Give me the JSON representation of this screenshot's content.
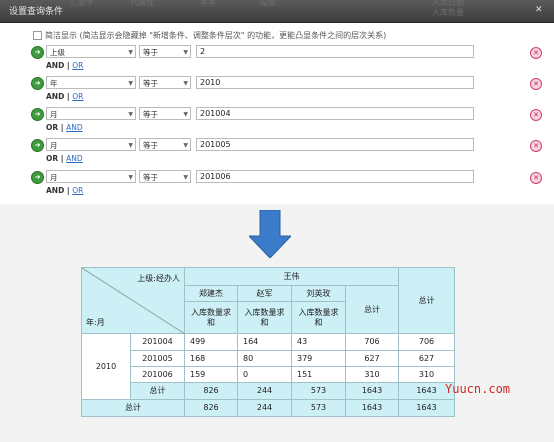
{
  "dialog": {
    "title": "设置查询条件",
    "bg_tabs": [
      "汇总字",
      "列属性",
      "等等",
      "设置",
      "入库日期",
      "入库数量"
    ],
    "simple_label": "简洁显示 (简洁显示会隐藏掉 \"新增条件、调整条件层次\" 的功能，更能凸显条件之间的层次关系)",
    "close_glyph": "✕",
    "conditions": [
      {
        "field": "上级",
        "op": "等于",
        "value": "2",
        "logic": "AND",
        "logic_alt": "OR"
      },
      {
        "field": "年",
        "op": "等于",
        "value": "2010",
        "logic": "AND",
        "logic_alt": "OR"
      },
      {
        "field": "月",
        "op": "等于",
        "value": "201004",
        "logic": "OR",
        "logic_alt": "AND"
      },
      {
        "field": "月",
        "op": "等于",
        "value": "201005",
        "logic": "OR",
        "logic_alt": "AND"
      },
      {
        "field": "月",
        "op": "等于",
        "value": "201006",
        "logic": "AND",
        "logic_alt": "OR"
      }
    ]
  },
  "colors": {
    "accent": "#3a7cc9",
    "header_bg": "#cdeff6",
    "watermark": "#d02a2a",
    "go": "#3e9c3e",
    "delete": "#c0275c"
  },
  "table": {
    "corner_top": "上级:经办人",
    "corner_bottom": "年:月",
    "group": "王伟",
    "total_label": "总计",
    "persons": [
      "郑建杰",
      "赵军",
      "刘英玫"
    ],
    "measure": "入库数量求和",
    "year": "2010",
    "rows": [
      {
        "month": "201004",
        "vals": [
          "499",
          "164",
          "43",
          "706",
          "706"
        ]
      },
      {
        "month": "201005",
        "vals": [
          "168",
          "80",
          "379",
          "627",
          "627"
        ]
      },
      {
        "month": "201006",
        "vals": [
          "159",
          "0",
          "151",
          "310",
          "310"
        ]
      }
    ],
    "subtotal": [
      "826",
      "244",
      "573",
      "1643",
      "1643"
    ],
    "grandtotal": [
      "826",
      "244",
      "573",
      "1643",
      "1643"
    ]
  },
  "watermark": "Yuucn.com"
}
